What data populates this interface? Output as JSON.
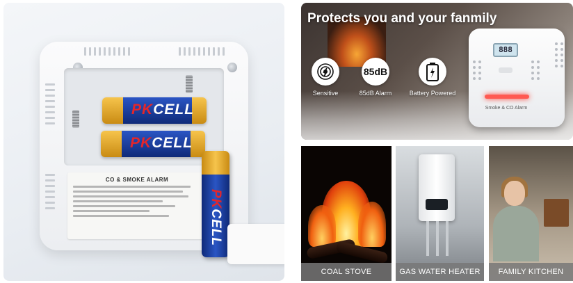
{
  "top_panel": {
    "headline": "Protects you and your fanmily",
    "features": [
      {
        "icon": "sensor-icon",
        "label": "Sensitive"
      },
      {
        "icon": "85dB",
        "label": "85dB Alarm"
      },
      {
        "icon": "battery-icon",
        "label": "Battery Powered"
      }
    ],
    "device": {
      "lcd": "888",
      "label": "Smoke & CO Alarm"
    }
  },
  "left_panel": {
    "battery_brand": "PKCELL",
    "battery_brand_prefix": "PK",
    "battery_brand_suffix": "CELL",
    "sticker_title": "CO & SMOKE ALARM"
  },
  "tiles": [
    {
      "caption": "COAL STOVE"
    },
    {
      "caption": "GAS WATER HEATER"
    },
    {
      "caption": "FAMILY KITCHEN"
    }
  ],
  "colors": {
    "battery_blue": "#1a3fa6",
    "battery_gold": "#e6a928",
    "alarm_red": "#ff3b30",
    "caption_bg": "#787878"
  }
}
